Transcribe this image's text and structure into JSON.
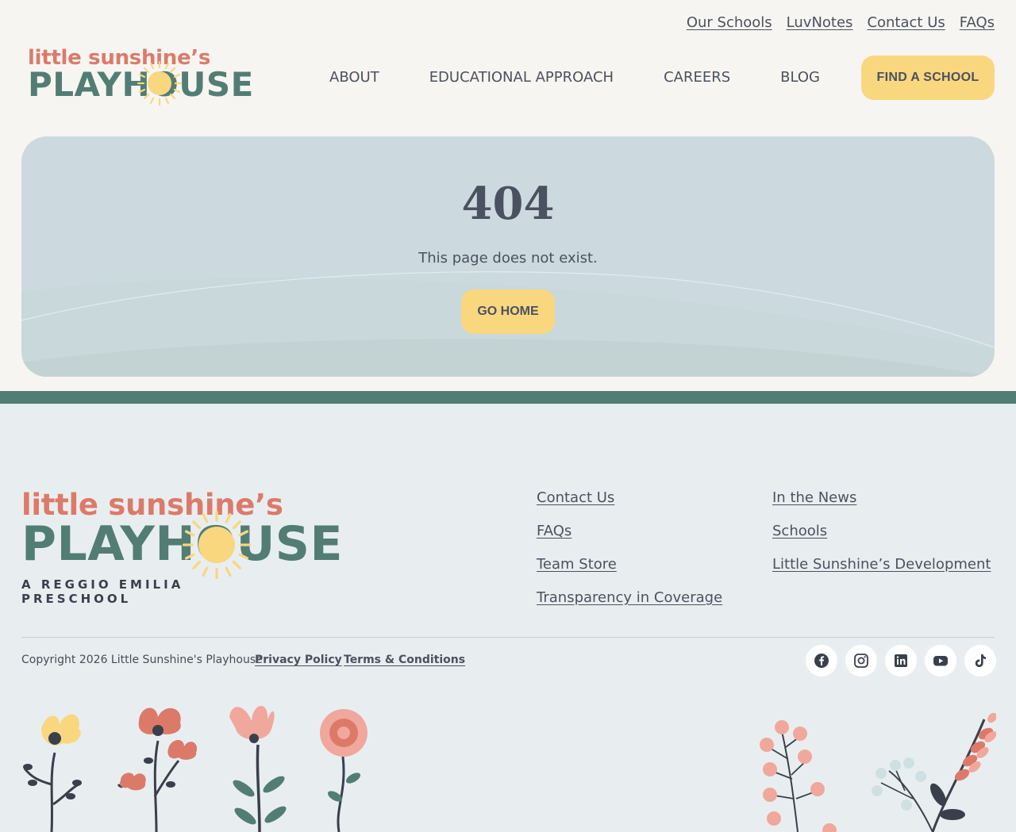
{
  "utility_nav": [
    "Our Schools",
    "LuvNotes",
    "Contact Us",
    "FAQs"
  ],
  "logo": {
    "small": "little sunshine’s",
    "big": "PLAYHOUSE",
    "tagline": "A REGGIO EMILIA PRESCHOOL"
  },
  "main_nav": [
    "ABOUT",
    "EDUCATIONAL APPROACH",
    "CAREERS",
    "BLOG"
  ],
  "cta_label": "FIND A SCHOOL",
  "hero": {
    "code": "404",
    "message": "This page does not exist.",
    "button": "GO HOME"
  },
  "footer": {
    "col1": [
      "Contact Us",
      "FAQs",
      "Team Store",
      "Transparency in Coverage"
    ],
    "col2": [
      "In the News",
      "Schools",
      "Little Sunshine’s Development"
    ],
    "copyright": "Copyright 2026 Little Sunshine's Playhouse",
    "legal": [
      "Privacy Policy",
      "Terms & Conditions"
    ],
    "socials": [
      "facebook-icon",
      "instagram-icon",
      "linkedin-icon",
      "youtube-icon",
      "tiktok-icon"
    ]
  },
  "colors": {
    "accent_yellow": "#f9d77f",
    "brand_green": "#527d74",
    "brand_coral": "#dc7a6a",
    "hero_bg": "#ccdadf",
    "footer_bg": "#e8eef0"
  }
}
